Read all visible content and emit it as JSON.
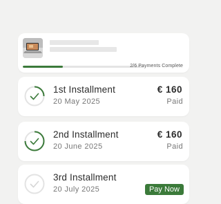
{
  "summary": {
    "progress_text": "2/6 Payments Complete",
    "paid_count": 2,
    "total_count": 6,
    "progress_fraction": 0.333
  },
  "installments": [
    {
      "title": "1st Installment",
      "date": "20 May 2025",
      "amount": "€ 160",
      "status": "Paid"
    },
    {
      "title": "2nd Installment",
      "date": "20 June 2025",
      "amount": "€ 160",
      "status": "Paid"
    },
    {
      "title": "3rd Installment",
      "date": "20 July 2025",
      "action_label": "Pay Now"
    }
  ],
  "colors": {
    "accent": "#3b7a3a",
    "background": "#f2f2f1",
    "card": "#ffffff"
  }
}
